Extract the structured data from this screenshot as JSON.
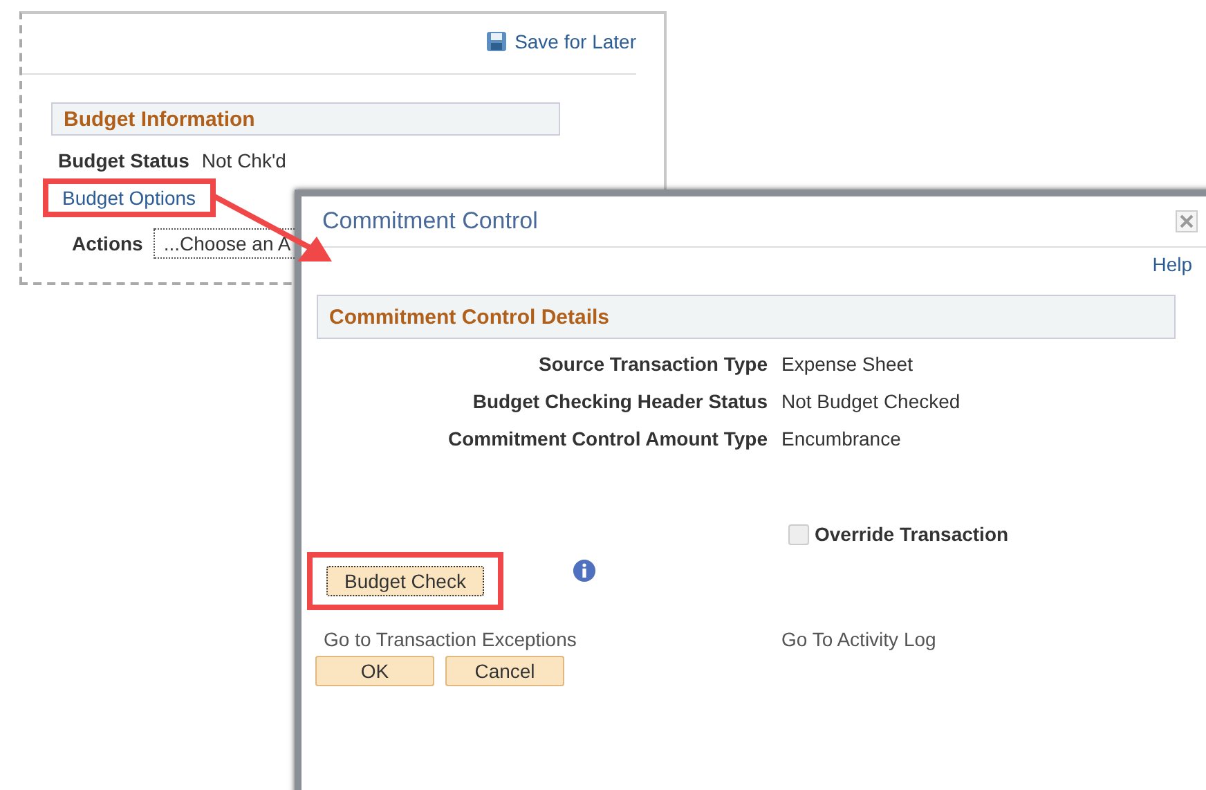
{
  "background_page": {
    "save_link": "Save for Later",
    "section_title": "Budget Information",
    "budget_status": {
      "label": "Budget Status",
      "value": "Not Chk'd"
    },
    "budget_options_link": "Budget Options",
    "actions": {
      "label": "Actions",
      "value": "...Choose an A"
    }
  },
  "dialog": {
    "title": "Commitment Control",
    "help_link": "Help",
    "section_title": "Commitment Control Details",
    "fields": [
      {
        "label": "Source Transaction Type",
        "value": "Expense Sheet"
      },
      {
        "label": "Budget Checking Header Status",
        "value": "Not Budget Checked"
      },
      {
        "label": "Commitment Control Amount Type",
        "value": "Encumbrance"
      }
    ],
    "override": {
      "label": "Override Transaction",
      "checked": false,
      "disabled": true
    },
    "budget_check_button": "Budget Check",
    "links": [
      "Go to Transaction Exceptions",
      "Go To Activity Log"
    ],
    "buttons": [
      "OK",
      "Cancel"
    ]
  }
}
